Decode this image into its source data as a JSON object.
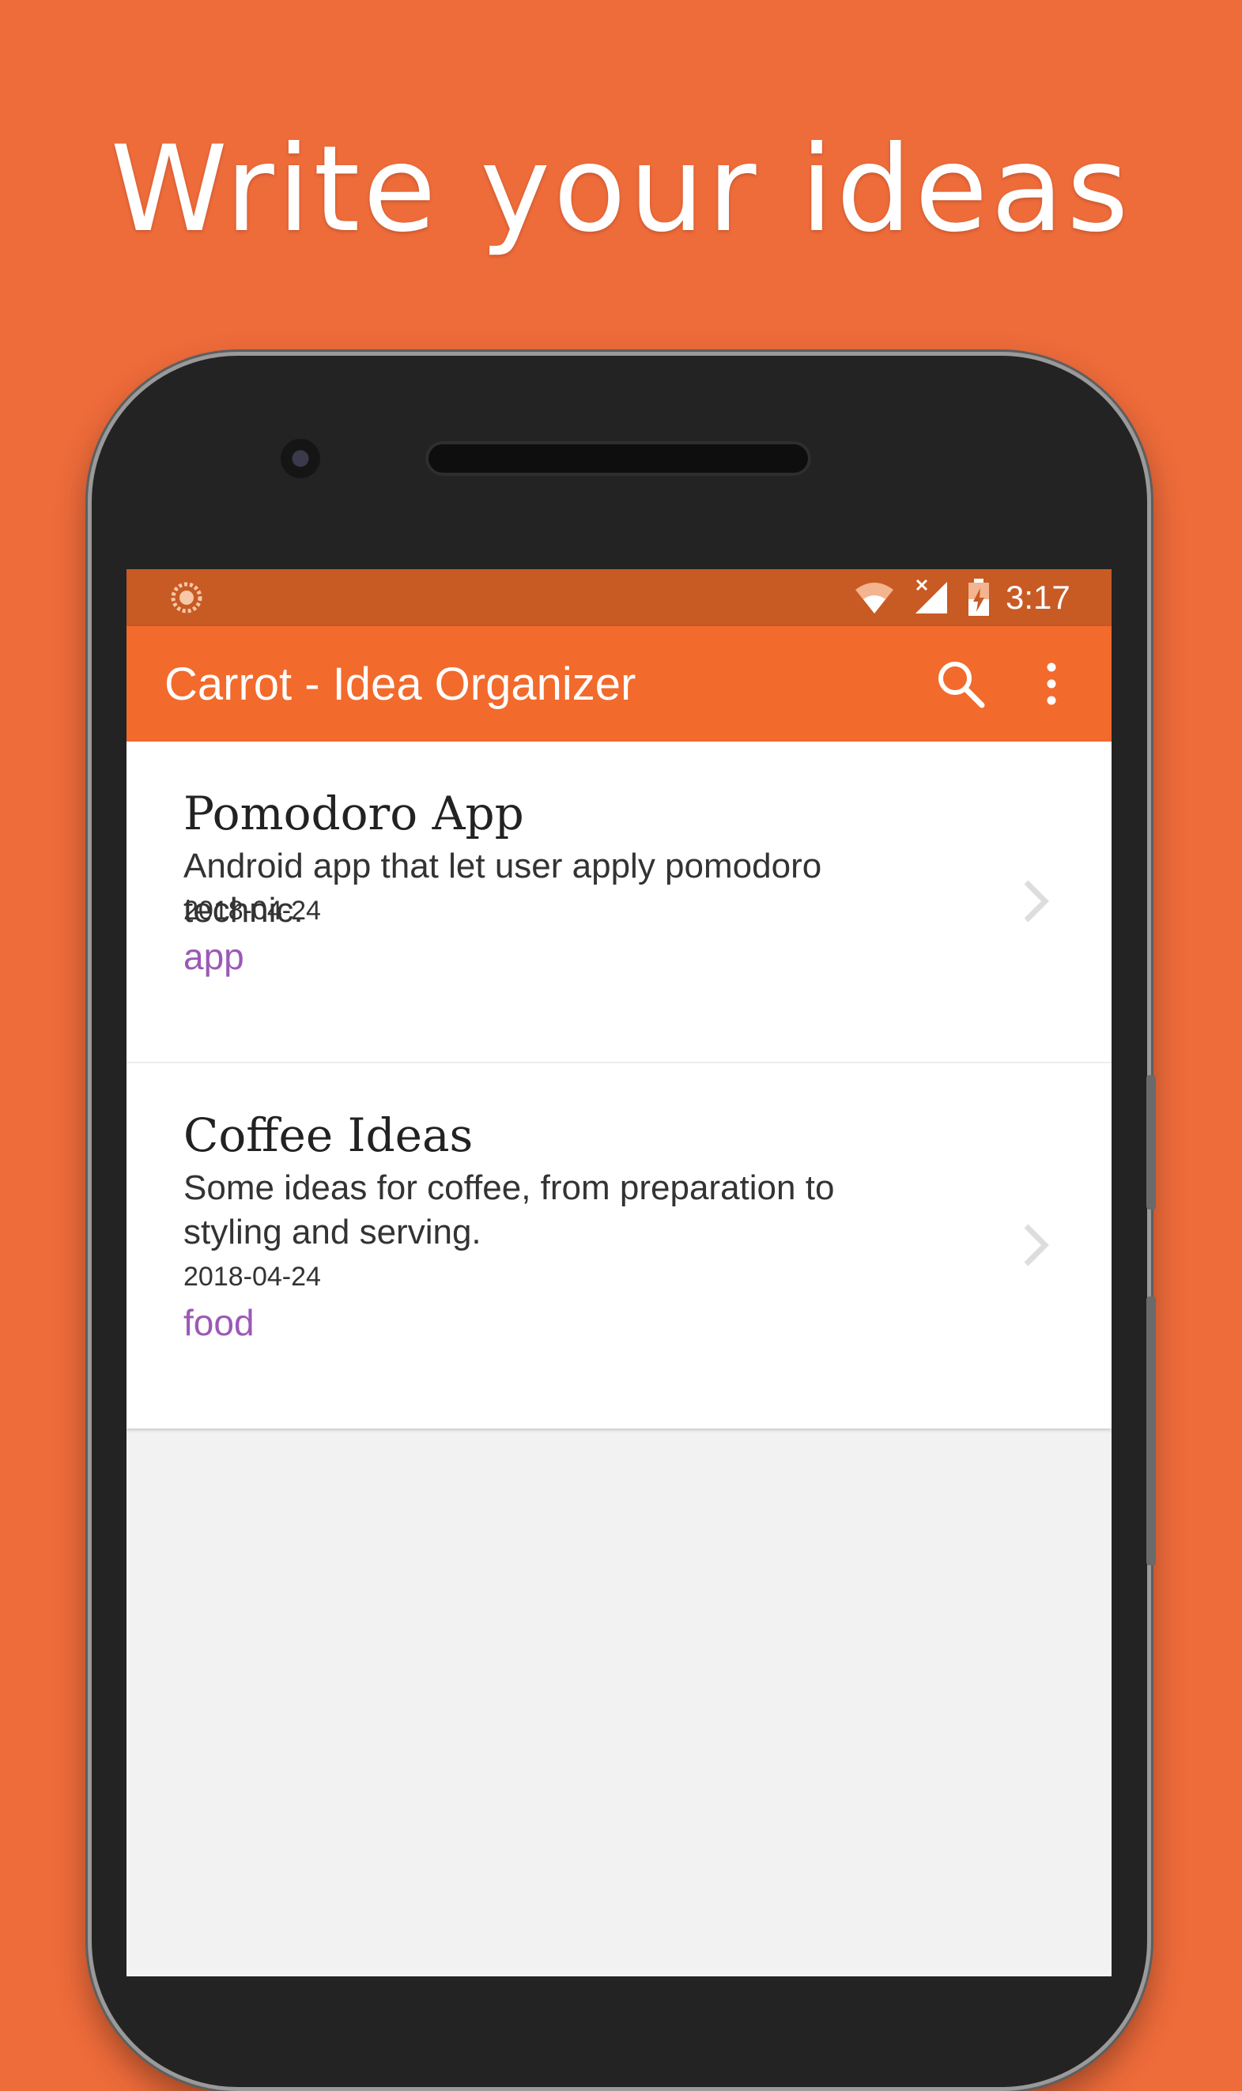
{
  "headline": "Write your ideas",
  "status_bar": {
    "time": "3:17",
    "background": "#C85A24"
  },
  "app_bar": {
    "title": "Carrot - Idea Organizer",
    "background": "#F26A2C",
    "actions": [
      "search-icon",
      "more-vert-icon"
    ]
  },
  "ideas": [
    {
      "title": "Pomodoro App",
      "description": "Android app that let user apply pomodoro technic.",
      "date": "2018-04-24",
      "tag": "app"
    },
    {
      "title": "Coffee Ideas",
      "description": "Some ideas for coffee, from preparation to styling and serving.",
      "date": "2018-04-24",
      "tag": "food"
    }
  ],
  "colors": {
    "page_background": "#EE6B3A",
    "tag": "#9B59B6",
    "screen_background": "#F2F2F2"
  }
}
